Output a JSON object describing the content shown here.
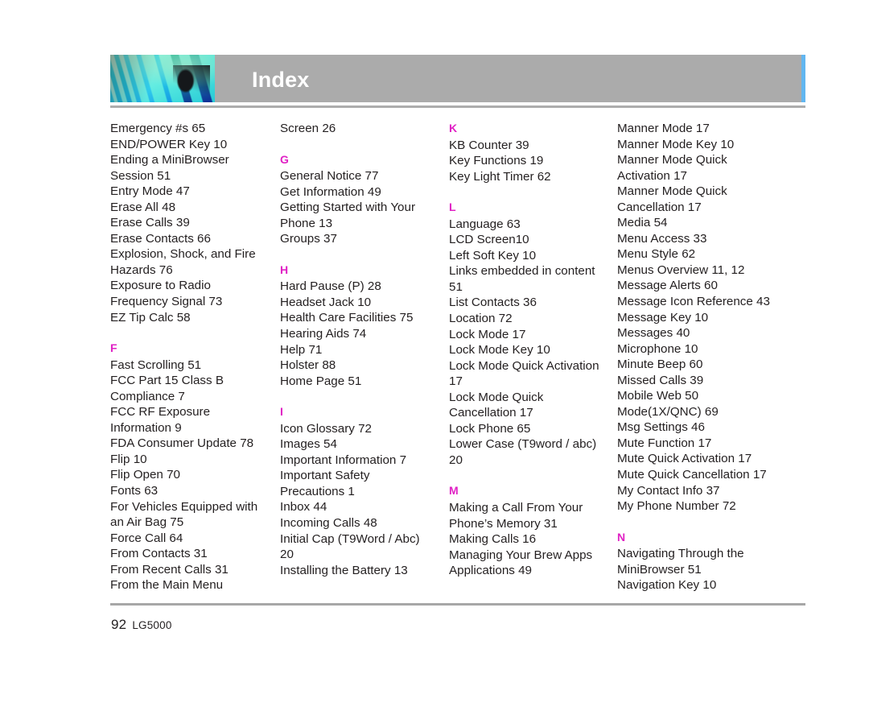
{
  "document": {
    "header_title": "Index",
    "band_color": "#ababab",
    "accent_color": "#62b6f0",
    "letter_color": "#e021c4",
    "text_color": "#231f20"
  },
  "footer": {
    "page_number": "92",
    "model": "LG5000"
  },
  "columns": [
    {
      "blocks": [
        {
          "type": "entries",
          "entries": [
            "Emergency #s 65",
            "END/POWER Key 10",
            "Ending a MiniBrowser",
            "Session 51",
            "Entry Mode 47",
            "Erase All 48",
            "Erase Calls 39",
            "Erase Contacts 66",
            "Explosion, Shock, and Fire",
            "Hazards 76",
            "Exposure to Radio",
            "Frequency Signal 73",
            "EZ Tip Calc 58"
          ]
        },
        {
          "type": "letter",
          "letter": "F"
        },
        {
          "type": "entries",
          "entries": [
            "Fast Scrolling 51",
            "FCC Part 15 Class B",
            "Compliance 7",
            "FCC RF Exposure",
            "Information 9",
            "FDA Consumer Update 78",
            "Flip 10",
            "Flip Open 70",
            "Fonts 63",
            "For Vehicles Equipped with",
            "an Air Bag 75",
            "Force Call 64",
            "From Contacts 31",
            "From Recent Calls 31",
            "From the Main Menu"
          ]
        }
      ]
    },
    {
      "blocks": [
        {
          "type": "entries",
          "entries": [
            "Screen 26"
          ]
        },
        {
          "type": "letter",
          "letter": "G"
        },
        {
          "type": "entries",
          "entries": [
            "General Notice 77",
            "Get Information 49",
            "Getting Started with Your",
            "Phone 13",
            "Groups 37"
          ]
        },
        {
          "type": "letter",
          "letter": "H"
        },
        {
          "type": "entries",
          "entries": [
            "Hard Pause (P) 28",
            "Headset Jack 10",
            "Health Care Facilities 75",
            "Hearing Aids 74",
            "Help 71",
            "Holster 88",
            "Home Page 51"
          ]
        },
        {
          "type": "letter",
          "letter": "I"
        },
        {
          "type": "entries",
          "entries": [
            "Icon Glossary 72",
            "Images 54",
            "Important Information 7",
            "Important Safety",
            "Precautions 1",
            "Inbox 44",
            "Incoming Calls 48",
            "Initial Cap (T9Word / Abc) 20",
            "Installing the Battery 13"
          ]
        }
      ]
    },
    {
      "blocks": [
        {
          "type": "letter",
          "letter": "K",
          "first": true
        },
        {
          "type": "entries",
          "entries": [
            "KB Counter 39",
            "Key Functions 19",
            "Key Light Timer 62"
          ]
        },
        {
          "type": "letter",
          "letter": "L"
        },
        {
          "type": "entries",
          "entries": [
            "Language 63",
            "LCD Screen10",
            "Left Soft Key 10",
            "Links embedded in content",
            "51",
            "List Contacts 36",
            "Location 72",
            "Lock Mode 17",
            "Lock Mode Key 10",
            "Lock Mode Quick Activation",
            "17",
            "Lock Mode Quick",
            "Cancellation 17",
            "Lock Phone 65",
            "Lower Case (T9word / abc)",
            "20"
          ]
        },
        {
          "type": "letter",
          "letter": "M"
        },
        {
          "type": "entries",
          "entries": [
            "Making a Call From Your",
            "Phone’s Memory 31",
            "Making Calls 16",
            "Managing Your Brew Apps",
            "Applications 49"
          ]
        }
      ]
    },
    {
      "blocks": [
        {
          "type": "entries",
          "entries": [
            "Manner Mode 17",
            "Manner Mode Key 10",
            "Manner Mode Quick",
            "Activation 17",
            "Manner Mode Quick",
            "Cancellation 17",
            "Media 54",
            "Menu Access 33",
            "Menu Style 62",
            "Menus Overview 11, 12",
            "Message Alerts 60",
            "Message Icon Reference 43",
            "Message Key 10",
            "Messages 40",
            "Microphone 10",
            "Minute Beep 60",
            "Missed Calls 39",
            "Mobile Web 50",
            "Mode(1X/QNC) 69",
            "Msg Settings 46",
            "Mute Function 17",
            "Mute Quick Activation 17",
            "Mute Quick Cancellation 17",
            "My Contact Info 37",
            "My Phone Number 72"
          ]
        },
        {
          "type": "letter",
          "letter": "N"
        },
        {
          "type": "entries",
          "entries": [
            "Navigating Through the",
            "MiniBrowser 51",
            "Navigation Key 10"
          ]
        }
      ]
    }
  ]
}
